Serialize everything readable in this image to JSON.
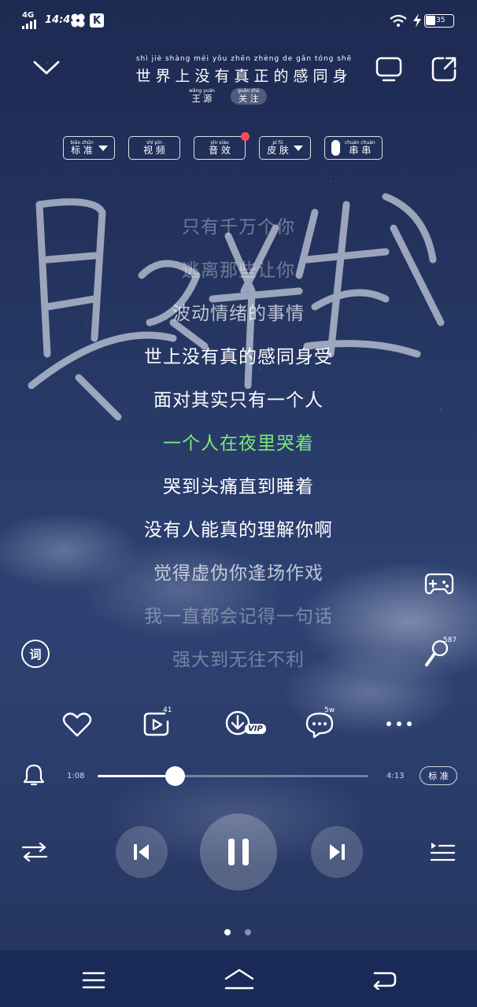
{
  "status_bar": {
    "network": "4G",
    "time": "14:41",
    "battery": "35"
  },
  "header": {
    "title_pinyin": "shì  jiè  shàng  méi  yǒu  zhēn  zhèng  de  gǎn  tóng  shē",
    "title": "世界上没有真正的感同身",
    "artist_pinyin": "wāng  yuán",
    "artist": "王 源",
    "follow_pinyin": "guān  zhù",
    "follow": "关 注"
  },
  "options": [
    {
      "pinyin": "biāo  zhǔn",
      "label": "标 准",
      "has_caret": true
    },
    {
      "pinyin": "shì  pín",
      "label": "视 频",
      "has_caret": false
    },
    {
      "pinyin": "yīn  xiào",
      "label": "音 效",
      "has_caret": false,
      "has_dot": true
    },
    {
      "pinyin": "pí  fū",
      "label": "皮 肤",
      "has_caret": true
    },
    {
      "pinyin": "chuàn  chuàn",
      "label": "串 串",
      "is_toggle": true
    }
  ],
  "lyrics": [
    {
      "text": "只有千万个你",
      "state": "faint"
    },
    {
      "text": "逃离那些让你",
      "state": "faint"
    },
    {
      "text": "波动情绪的事情",
      "state": "mid"
    },
    {
      "text": "世上没有真的感同身受",
      "state": "normal"
    },
    {
      "text": "面对其实只有一个人",
      "state": "normal"
    },
    {
      "text": "一个人在夜里哭着",
      "state": "active"
    },
    {
      "text": "哭到头痛直到睡着",
      "state": "normal"
    },
    {
      "text": "没有人能真的理解你啊",
      "state": "normal"
    },
    {
      "text": "觉得虚伪你逢场作戏",
      "state": "mid"
    },
    {
      "text": "我一直都会记得一句话",
      "state": "faint"
    },
    {
      "text": "强大到无往不利",
      "state": "faint"
    }
  ],
  "side": {
    "lyrics_icon_label": "词",
    "mic_count": "587"
  },
  "actions": {
    "share_count": "41",
    "vip_label": "VIP",
    "comment_count": "5w"
  },
  "progress": {
    "current": "1:08",
    "total": "4:13",
    "fraction": 0.286,
    "quality_label": "标 准"
  },
  "colors": {
    "active_lyric": "#7ce87a",
    "dot_red": "#ff4d5a"
  },
  "pager": {
    "count": 2,
    "active": 0
  }
}
